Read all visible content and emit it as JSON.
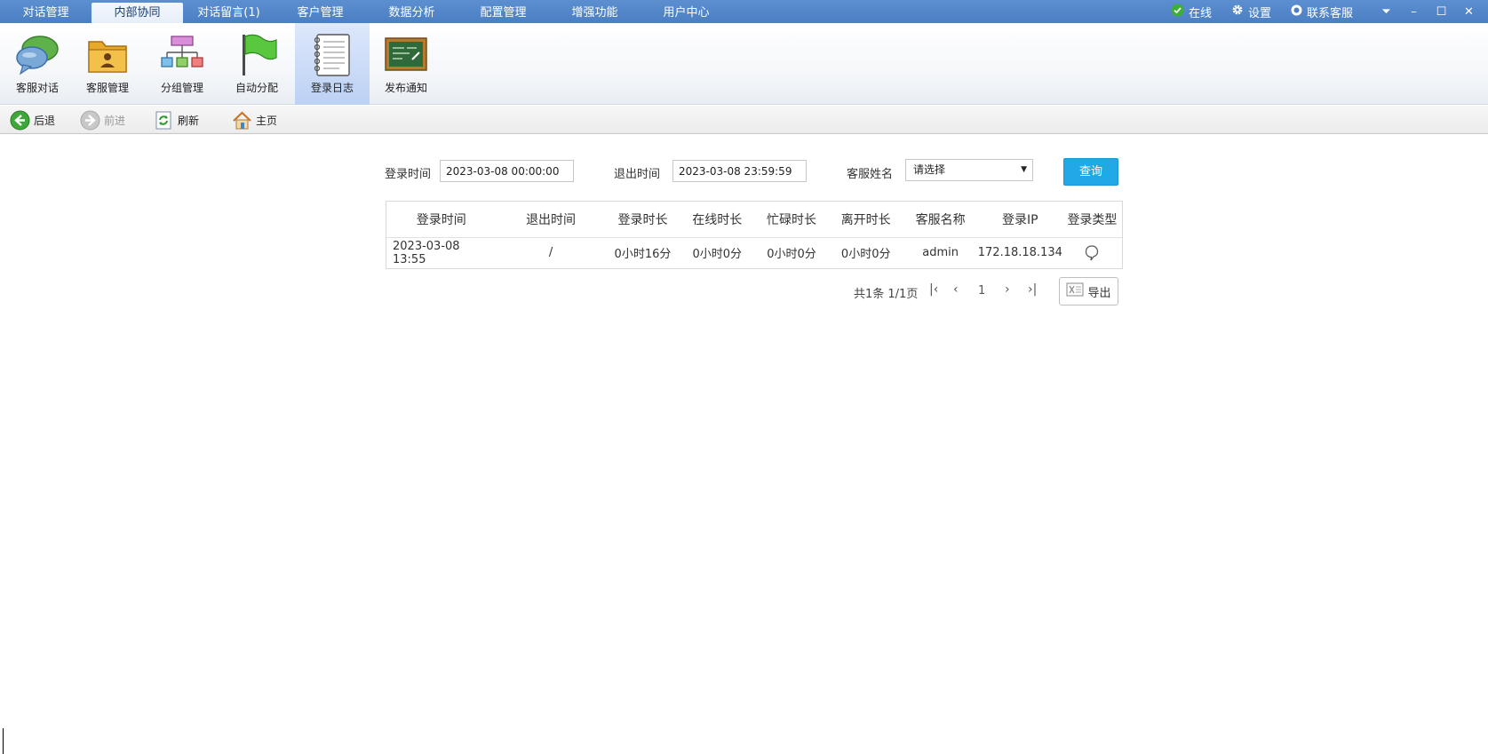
{
  "menu": {
    "tabs": [
      "对话管理",
      "内部协同",
      "对话留言(1)",
      "客户管理",
      "数据分析",
      "配置管理",
      "增强功能",
      "用户中心"
    ],
    "active_tab": "内部协同",
    "status_label": "在线",
    "settings_label": "设置",
    "contact_label": "联系客服"
  },
  "toolbar": {
    "items": [
      {
        "label": "客服对话",
        "icon": "chat-bubbles-icon"
      },
      {
        "label": "客服管理",
        "icon": "agent-folder-icon"
      },
      {
        "label": "分组管理",
        "icon": "org-chart-icon"
      },
      {
        "label": "自动分配",
        "icon": "green-flag-icon"
      },
      {
        "label": "登录日志",
        "icon": "notebook-icon"
      },
      {
        "label": "发布通知",
        "icon": "blackboard-icon"
      }
    ],
    "active": "登录日志"
  },
  "nav": {
    "back": "后退",
    "forward": "前进",
    "refresh": "刷新",
    "home": "主页"
  },
  "filters": {
    "login_time_label": "登录时间",
    "login_time_value": "2023-03-08 00:00:00",
    "logout_time_label": "退出时间",
    "logout_time_value": "2023-03-08 23:59:59",
    "agent_name_label": "客服姓名",
    "agent_name_value": "请选择",
    "query_button": "查询"
  },
  "table": {
    "headers": [
      "登录时间",
      "退出时间",
      "登录时长",
      "在线时长",
      "忙碌时长",
      "离开时长",
      "客服名称",
      "登录IP",
      "登录类型"
    ],
    "rows": [
      [
        "2023-03-08 13:55",
        "/",
        "0小时16分",
        "0小时0分",
        "0小时0分",
        "0小时0分",
        "admin",
        "172.18.18.134",
        ""
      ]
    ]
  },
  "pagination": {
    "summary": "共1条 1/1页",
    "current_page": "1",
    "export_label": "导出"
  },
  "colors": {
    "menubar": "#4b7fc3",
    "accent": "#22a7e7",
    "online": "#3cb034"
  }
}
